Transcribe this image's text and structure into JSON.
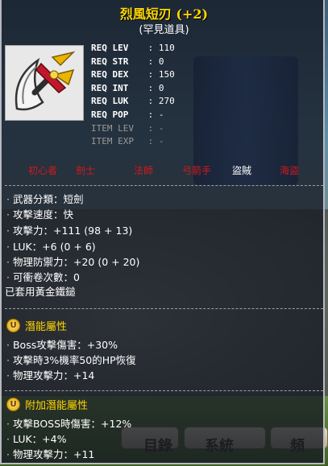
{
  "item": {
    "name": "烈風短刃 (+2)",
    "rarity": "(罕見道具)"
  },
  "requirements": [
    {
      "label": "REQ LEV",
      "value": "110",
      "dim": false
    },
    {
      "label": "REQ STR",
      "value": "0",
      "dim": false
    },
    {
      "label": "REQ DEX",
      "value": "150",
      "dim": false
    },
    {
      "label": "REQ INT",
      "value": "0",
      "dim": false
    },
    {
      "label": "REQ LUK",
      "value": "270",
      "dim": false
    },
    {
      "label": "REQ POP",
      "value": "-",
      "dim": false
    },
    {
      "label": "ITEM LEV",
      "value": "-",
      "dim": true
    },
    {
      "label": "ITEM EXP",
      "value": "-",
      "dim": true
    }
  ],
  "jobs": [
    {
      "label": "初心者",
      "active": false
    },
    {
      "label": "劍士",
      "active": false
    },
    {
      "label": "法師",
      "active": false
    },
    {
      "label": "弓箭手",
      "active": false
    },
    {
      "label": "盜賊",
      "active": true
    },
    {
      "label": "海盜",
      "active": false
    }
  ],
  "stats": [
    "武器分類：短劍",
    "攻擊速度：快",
    "攻擊力：+111 (98 + 13)",
    "LUK：+6 (0 + 6)",
    "物理防禦力：+20 (0 + 20)",
    "可衝卷次數：0"
  ],
  "golden_note": "已套用黃金鐵鎚",
  "potential": {
    "badge": "U",
    "title": "潛能屬性",
    "lines": [
      "Boss攻擊傷害：+30%",
      "攻擊時3%機率50的HP恢復",
      "物理攻擊力：+14"
    ]
  },
  "bonus_potential": {
    "badge": "U",
    "title": "附加潛能屬性",
    "lines": [
      "攻擊BOSS時傷害：+12%",
      "LUK：+4%",
      "物理攻擊力：+11"
    ]
  },
  "background_buttons": [
    "目錄",
    "系統",
    "頻"
  ],
  "colors": {
    "title": "#ffd900",
    "section": "#ffd600",
    "job_disabled": "#d31a1a",
    "job_active": "#ffffff"
  },
  "icon": "dagger-icon"
}
